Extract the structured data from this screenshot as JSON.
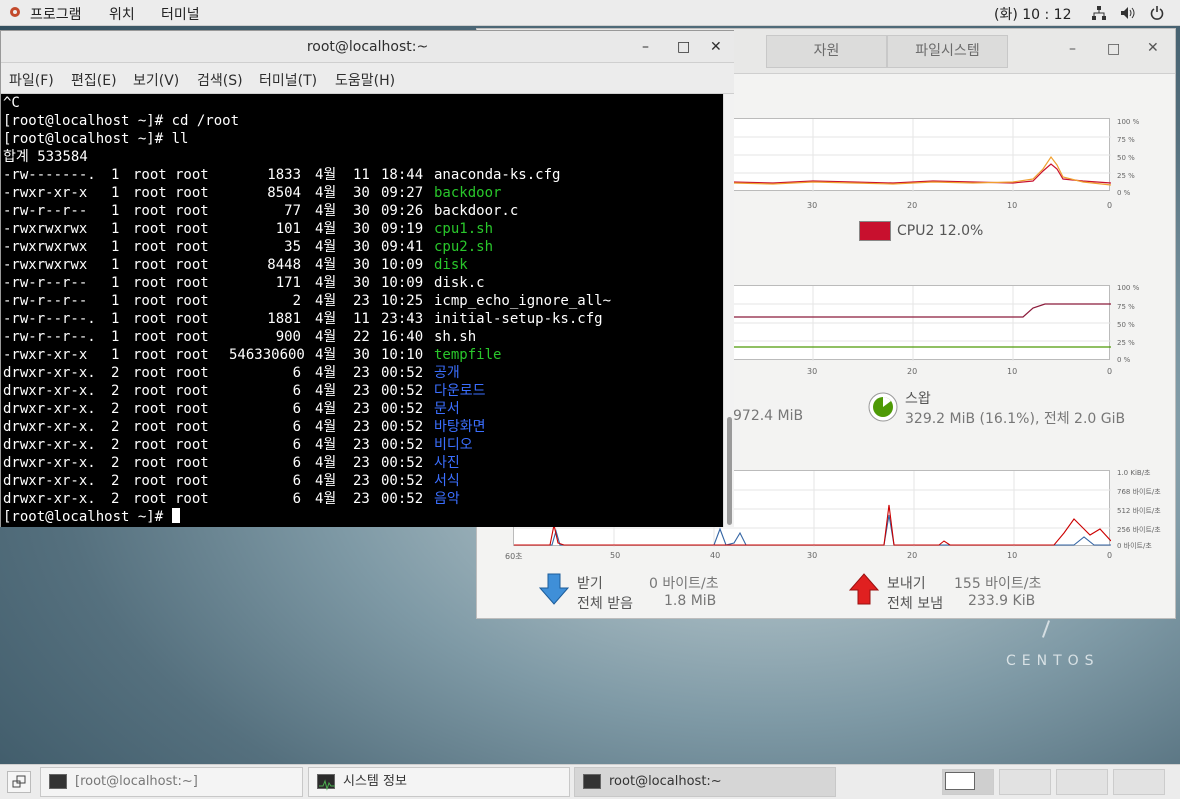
{
  "topbar": {
    "programs": "프로그램",
    "places": "위치",
    "terminal": "터미널",
    "clock": "(화) 10 : 12"
  },
  "desktop": {
    "centos": "CENTOS"
  },
  "terminal": {
    "title": "root@localhost:~",
    "menu": [
      "파일(F)",
      "편집(E)",
      "보기(V)",
      "검색(S)",
      "터미널(T)",
      "도움말(H)"
    ],
    "lines_pre": [
      "^C",
      "[root@localhost ~]# cd /root",
      "[root@localhost ~]# ll",
      "합계 533584"
    ],
    "rows": [
      {
        "perm": "-rw-------.",
        "n": "1",
        "u": "root",
        "g": "root",
        "size": "1833",
        "mon": "4월",
        "day": "11",
        "time": "18:44",
        "name": "anaconda-ks.cfg",
        "color": "w"
      },
      {
        "perm": "-rwxr-xr-x",
        "n": "1",
        "u": "root",
        "g": "root",
        "size": "8504",
        "mon": "4월",
        "day": "30",
        "time": "09:27",
        "name": "backdoor",
        "color": "g"
      },
      {
        "perm": "-rw-r--r--",
        "n": "1",
        "u": "root",
        "g": "root",
        "size": "77",
        "mon": "4월",
        "day": "30",
        "time": "09:26",
        "name": "backdoor.c",
        "color": "w"
      },
      {
        "perm": "-rwxrwxrwx",
        "n": "1",
        "u": "root",
        "g": "root",
        "size": "101",
        "mon": "4월",
        "day": "30",
        "time": "09:19",
        "name": "cpu1.sh",
        "color": "g"
      },
      {
        "perm": "-rwxrwxrwx",
        "n": "1",
        "u": "root",
        "g": "root",
        "size": "35",
        "mon": "4월",
        "day": "30",
        "time": "09:41",
        "name": "cpu2.sh",
        "color": "g"
      },
      {
        "perm": "-rwxrwxrwx",
        "n": "1",
        "u": "root",
        "g": "root",
        "size": "8448",
        "mon": "4월",
        "day": "30",
        "time": "10:09",
        "name": "disk",
        "color": "g"
      },
      {
        "perm": "-rw-r--r--",
        "n": "1",
        "u": "root",
        "g": "root",
        "size": "171",
        "mon": "4월",
        "day": "30",
        "time": "10:09",
        "name": "disk.c",
        "color": "w"
      },
      {
        "perm": "-rw-r--r--",
        "n": "1",
        "u": "root",
        "g": "root",
        "size": "2",
        "mon": "4월",
        "day": "23",
        "time": "10:25",
        "name": "icmp_echo_ignore_all~",
        "color": "w"
      },
      {
        "perm": "-rw-r--r--.",
        "n": "1",
        "u": "root",
        "g": "root",
        "size": "1881",
        "mon": "4월",
        "day": "11",
        "time": "23:43",
        "name": "initial-setup-ks.cfg",
        "color": "w"
      },
      {
        "perm": "-rw-r--r--.",
        "n": "1",
        "u": "root",
        "g": "root",
        "size": "900",
        "mon": "4월",
        "day": "22",
        "time": "16:40",
        "name": "sh.sh",
        "color": "w"
      },
      {
        "perm": "-rwxr-xr-x",
        "n": "1",
        "u": "root",
        "g": "root",
        "size": "546330600",
        "mon": "4월",
        "day": "30",
        "time": "10:10",
        "name": "tempfile",
        "color": "g"
      },
      {
        "perm": "drwxr-xr-x.",
        "n": "2",
        "u": "root",
        "g": "root",
        "size": "6",
        "mon": "4월",
        "day": "23",
        "time": "00:52",
        "name": "공개",
        "color": "b"
      },
      {
        "perm": "drwxr-xr-x.",
        "n": "2",
        "u": "root",
        "g": "root",
        "size": "6",
        "mon": "4월",
        "day": "23",
        "time": "00:52",
        "name": "다운로드",
        "color": "b"
      },
      {
        "perm": "drwxr-xr-x.",
        "n": "2",
        "u": "root",
        "g": "root",
        "size": "6",
        "mon": "4월",
        "day": "23",
        "time": "00:52",
        "name": "문서",
        "color": "b"
      },
      {
        "perm": "drwxr-xr-x.",
        "n": "2",
        "u": "root",
        "g": "root",
        "size": "6",
        "mon": "4월",
        "day": "23",
        "time": "00:52",
        "name": "바탕화면",
        "color": "b"
      },
      {
        "perm": "drwxr-xr-x.",
        "n": "2",
        "u": "root",
        "g": "root",
        "size": "6",
        "mon": "4월",
        "day": "23",
        "time": "00:52",
        "name": "비디오",
        "color": "b"
      },
      {
        "perm": "drwxr-xr-x.",
        "n": "2",
        "u": "root",
        "g": "root",
        "size": "6",
        "mon": "4월",
        "day": "23",
        "time": "00:52",
        "name": "사진",
        "color": "b"
      },
      {
        "perm": "drwxr-xr-x.",
        "n": "2",
        "u": "root",
        "g": "root",
        "size": "6",
        "mon": "4월",
        "day": "23",
        "time": "00:52",
        "name": "서식",
        "color": "b"
      },
      {
        "perm": "drwxr-xr-x.",
        "n": "2",
        "u": "root",
        "g": "root",
        "size": "6",
        "mon": "4월",
        "day": "23",
        "time": "00:52",
        "name": "음악",
        "color": "b"
      }
    ],
    "prompt": "[root@localhost ~]# "
  },
  "sysmon": {
    "tabs": [
      "자원",
      "파일시스템"
    ],
    "cpu": {
      "y_ticks": [
        "100 %",
        "75 %",
        "50 %",
        "25 %",
        "0 %"
      ],
      "x_ticks": [
        "30",
        "20",
        "10",
        "0"
      ],
      "legend": "CPU2 12.0%",
      "legend_color": "#c8102e"
    },
    "mem": {
      "y_ticks": [
        "100 %",
        "75 %",
        "50 %",
        "25 %",
        "0 %"
      ],
      "x_ticks": [
        "30",
        "20",
        "10",
        "0"
      ],
      "mem_partial": "972.4 MiB",
      "swap_label": "스왑",
      "swap_value": "329.2 MiB (16.1%), 전체 2.0 GiB"
    },
    "net": {
      "y_ticks": [
        "1.0 KiB/초",
        "768 바이트/초",
        "512 바이트/초",
        "256 바이트/초",
        "0 바이트/초"
      ],
      "x_ticks": [
        "60초",
        "50",
        "40",
        "30",
        "20",
        "10",
        "0"
      ],
      "recv_label": "받기",
      "recv_rate": "0 바이트/초",
      "recv_total_label": "전체 받음",
      "recv_total": "1.8 MiB",
      "send_label": "보내기",
      "send_rate": "155 바이트/초",
      "send_total_label": "전체 보냄",
      "send_total": "233.9 KiB"
    }
  },
  "taskbar": {
    "tasks": [
      "[root@localhost:~]",
      "시스템 정보",
      "root@localhost:~"
    ]
  }
}
